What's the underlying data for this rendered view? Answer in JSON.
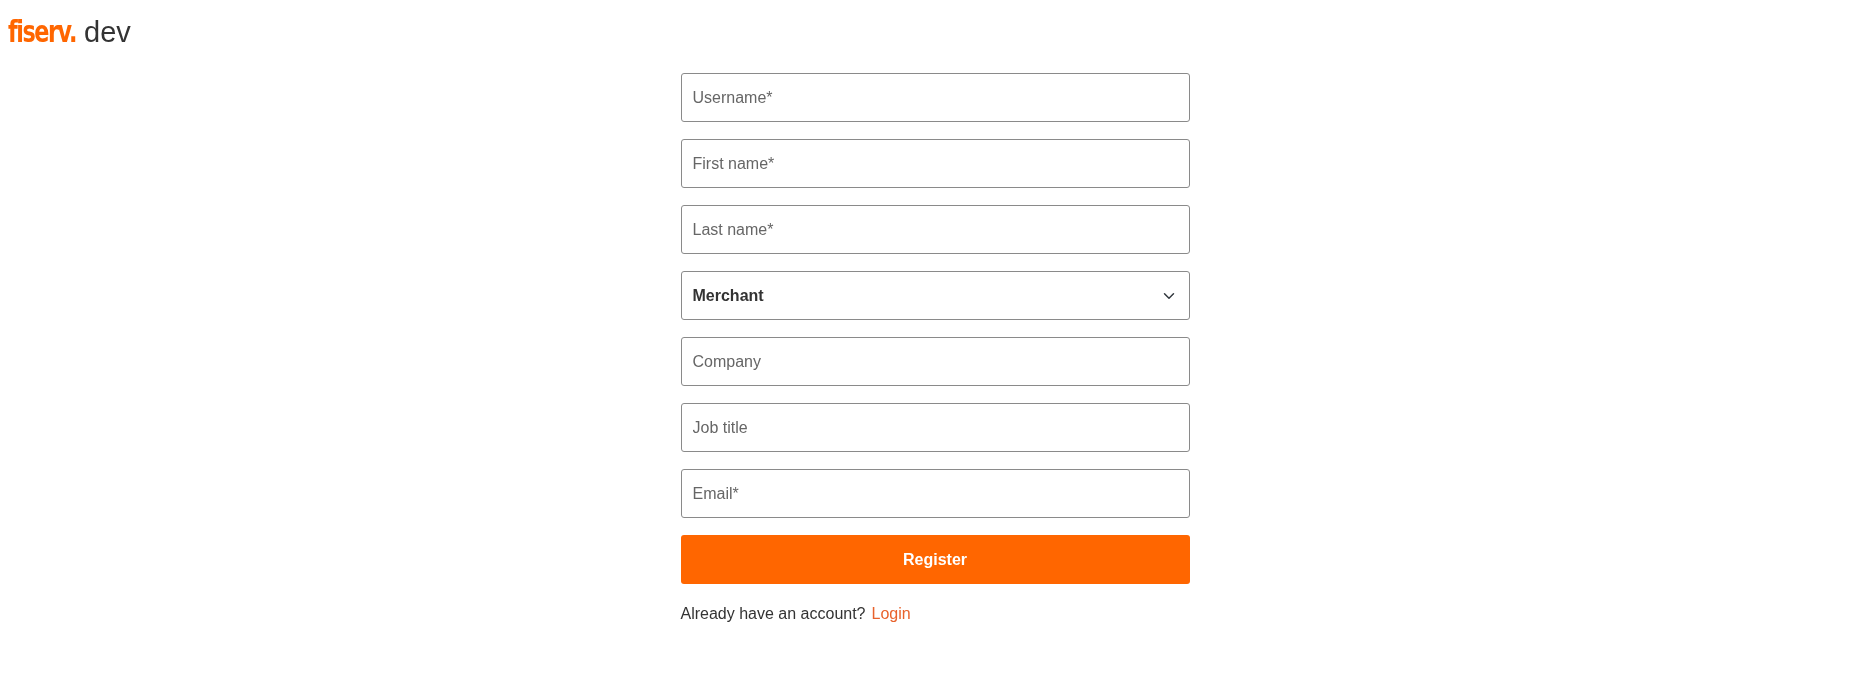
{
  "logo": {
    "brand": "fiserv.",
    "suffix": "dev"
  },
  "fields": [
    {
      "kind": "input",
      "placeholder": "Username*"
    },
    {
      "kind": "input",
      "placeholder": "First name*"
    },
    {
      "kind": "input",
      "placeholder": "Last name*"
    },
    {
      "kind": "select",
      "value": "Merchant"
    },
    {
      "kind": "input",
      "placeholder": "Company"
    },
    {
      "kind": "input",
      "placeholder": "Job title"
    },
    {
      "kind": "input",
      "placeholder": "Email*"
    }
  ],
  "submit": "Register",
  "footer": {
    "prompt": "Already have an account?",
    "link": "Login"
  }
}
